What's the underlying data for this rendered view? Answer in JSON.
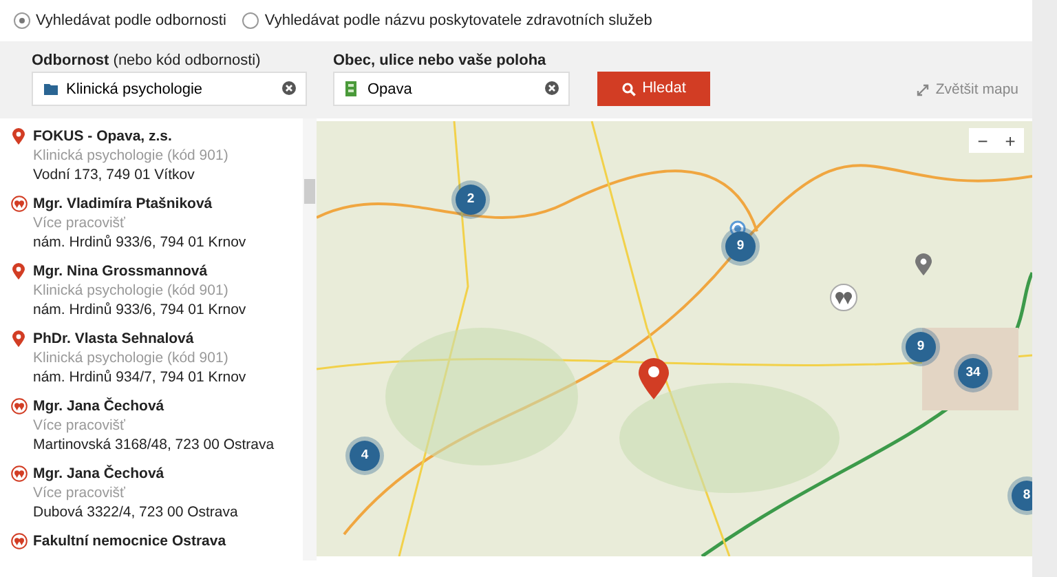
{
  "search_mode": [
    {
      "label": "Vyhledávat podle odbornosti",
      "selected": true
    },
    {
      "label": "Vyhledávat podle názvu poskytovatele zdravotních služeb",
      "selected": false
    }
  ],
  "search_panel": {
    "specialty_label": "**Odbornost** (nebo kód odbornosti)",
    "specialty_value": "Klinická psychologie",
    "location_label": "Obec, ulice nebo vaše poloha",
    "location_value": "Opava",
    "search_button": "Hledat",
    "enlarge_map": "Zvětšit mapu"
  },
  "results": [
    {
      "kind": "pin",
      "name": "FOKUS - Opava, z.s.",
      "detail": "Klinická psychologie (kód 901)",
      "address": "Vodní 173, 749 01 Vítkov"
    },
    {
      "kind": "multi",
      "name": "Mgr. Vladimíra Ptašniková",
      "detail": "Více pracovišť",
      "address": "nám. Hrdinů 933/6, 794 01 Krnov"
    },
    {
      "kind": "pin",
      "name": "Mgr. Nina Grossmannová",
      "detail": "Klinická psychologie (kód 901)",
      "address": "nám. Hrdinů 933/6, 794 01 Krnov"
    },
    {
      "kind": "pin",
      "name": "PhDr. Vlasta Sehnalová",
      "detail": "Klinická psychologie (kód 901)",
      "address": "nám. Hrdinů 934/7, 794 01 Krnov"
    },
    {
      "kind": "multi",
      "name": "Mgr. Jana Čechová",
      "detail": "Více pracovišť",
      "address": "Martinovská 3168/48, 723 00 Ostrava"
    },
    {
      "kind": "multi",
      "name": "Mgr. Jana Čechová",
      "detail": "Více pracovišť",
      "address": "Dubová 3322/4, 723 00 Ostrava"
    },
    {
      "kind": "multi",
      "name": "Fakultní nemocnice Ostrava"
    }
  ],
  "map": {
    "zoom_out": "−",
    "zoom_in": "+",
    "clusters": [
      "2",
      "9",
      "4",
      "9",
      "34",
      "8"
    ]
  }
}
